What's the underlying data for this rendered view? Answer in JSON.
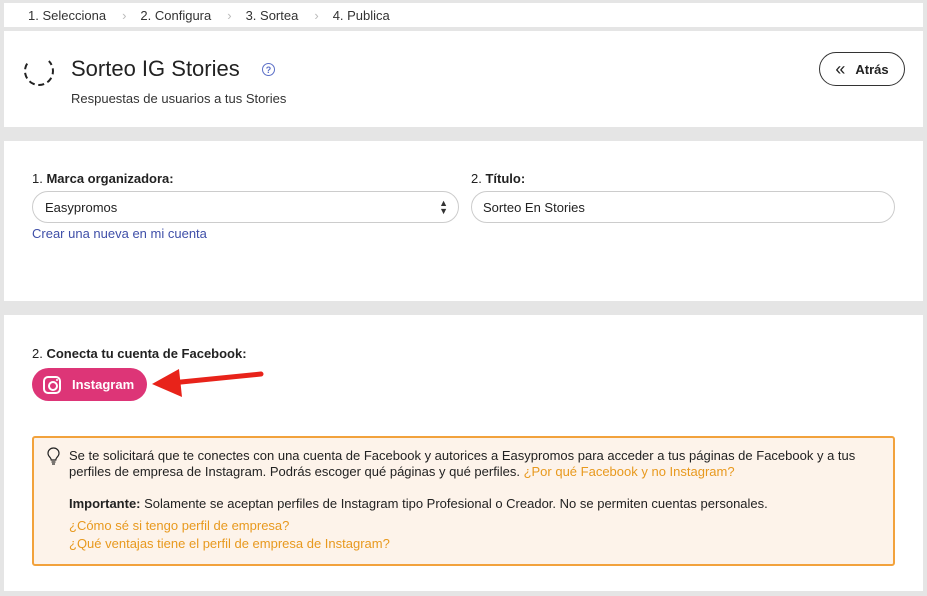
{
  "steps": [
    "1. Selecciona",
    "2. Configura",
    "3. Sortea",
    "4. Publica"
  ],
  "header": {
    "title": "Sorteo IG Stories",
    "subtitle": "Respuestas de usuarios a tus Stories",
    "back_label": "Atrás"
  },
  "form": {
    "brand_num": "1.",
    "brand_label": "Marca organizadora:",
    "brand_value": "Easypromos",
    "create_link": "Crear una nueva en mi cuenta",
    "title_num": "2.",
    "title_label": "Título:",
    "title_value": "Sorteo En Stories"
  },
  "connect": {
    "num": "2.",
    "label": "Conecta tu cuenta de Facebook:",
    "button_label": "Instagram"
  },
  "notice": {
    "text": "Se te solicitará que te conectes con una cuenta de Facebook y autorices a Easypromos para acceder a tus páginas de Facebook y a tus perfiles de empresa de Instagram. Podrás escoger qué páginas y qué perfiles.",
    "why_link": "¿Por qué Facebook y no Instagram?",
    "important_label": "Importante:",
    "important_text": "Solamente se aceptan perfiles de Instagram tipo Profesional o Creador. No se permiten cuentas personales.",
    "link1": "¿Cómo sé si tengo perfil de empresa?",
    "link2": "¿Qué ventajas tiene el perfil de empresa de Instagram?"
  },
  "colors": {
    "instagram_button": "#dd3577",
    "notice_border": "#f2a23c",
    "notice_bg": "#fdf3ea",
    "link_blue": "#3f4fa8",
    "link_orange": "#e8991e",
    "arrow": "#e8231a"
  },
  "icons": [
    "loading-spinner-icon",
    "help-circle-icon",
    "double-chevron-left-icon",
    "instagram-icon",
    "lightbulb-icon",
    "red-arrow-icon"
  ]
}
